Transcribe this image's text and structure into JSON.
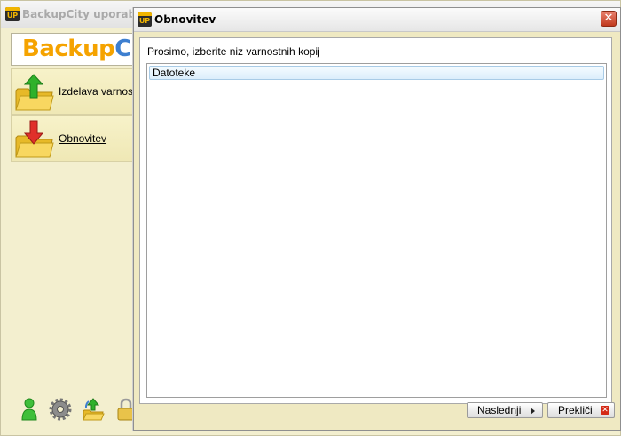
{
  "main_window": {
    "title": "BackupCity uporabniš",
    "app_icon_text": "UP",
    "logo": {
      "part1": "Backup",
      "part2": "C"
    },
    "sidebar": {
      "items": [
        {
          "label": "Izdelava varnostn",
          "icon": "folder-upload-icon"
        },
        {
          "label": "Obnovitev",
          "icon": "folder-download-icon"
        }
      ]
    },
    "bottom_toolbar": {
      "icons": [
        "user-icon",
        "gear-icon",
        "refresh-upload-icon",
        "lock-icon"
      ]
    }
  },
  "dialog": {
    "title": "Obnovitev",
    "app_icon_text": "UP",
    "close_glyph": "✕",
    "prompt": "Prosimo, izberite niz varnostnih kopij",
    "list_items": [
      {
        "label": "Datoteke",
        "selected": true
      }
    ],
    "buttons": {
      "next_label": "Naslednji",
      "cancel_label": "Prekliči",
      "cancel_glyph": "✕"
    }
  },
  "colors": {
    "background": "#f3efcf",
    "logo_orange": "#f5a300",
    "logo_blue": "#3d7fd0",
    "selection": "#dbeefb",
    "close_red": "#c0391d"
  }
}
